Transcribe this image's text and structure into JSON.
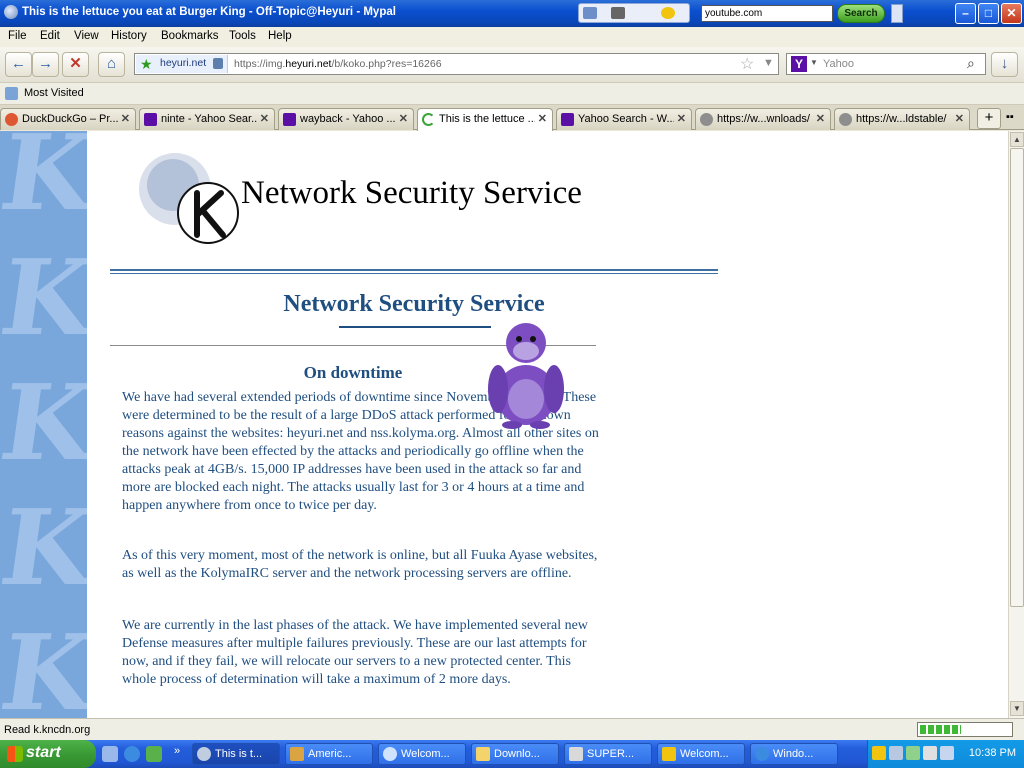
{
  "window": {
    "title": "This is the lettuce you eat at Burger King - Off-Topic@Heyuri - Mypal",
    "toolbar_search_value": "youtube.com",
    "toolbar_search_button": "Search"
  },
  "menu": [
    "File",
    "Edit",
    "View",
    "History",
    "Bookmarks",
    "Tools",
    "Help"
  ],
  "navigation": {
    "site_identity": "heyuri.net",
    "url_prefix": "https://img.",
    "url_host": "heyuri.net",
    "url_path": "/b/koko.php?res=16266",
    "search_engine": "Yahoo"
  },
  "bookmarks": {
    "most_visited": "Most Visited"
  },
  "tabs": [
    {
      "label": "DuckDuckGo – Pr...",
      "icon": "duckduckgo-icon",
      "active": false
    },
    {
      "label": "ninte - Yahoo Sear...",
      "icon": "yahoo-icon",
      "active": false
    },
    {
      "label": "wayback - Yahoo ...",
      "icon": "yahoo-icon",
      "active": false
    },
    {
      "label": "This is the lettuce ...",
      "icon": "loading-icon",
      "active": true
    },
    {
      "label": "Yahoo Search - W...",
      "icon": "yahoo-icon",
      "active": false
    },
    {
      "label": "https://w...wnloads/",
      "icon": "globe-icon",
      "active": false
    },
    {
      "label": "https://w...ldstable/",
      "icon": "globe-icon",
      "active": false
    }
  ],
  "page": {
    "header_title": "Network Security Service",
    "section_title": "Network Security Service",
    "sub_title": "On downtime",
    "paragraphs": [
      "We have had several extended periods of downtime since November this year. These were determined to be the result of a large DDoS attack performed for unknown reasons against the websites: heyuri.net and nss.kolyma.org. Almost all other sites on the network have been effected by the attacks and periodically go offline when the attacks peak at 4GB/s. 15,000 IP addresses have been used in the attack so far and more are blocked each night. The attacks usually last for 3 or 4 hours at a time and happen anywhere from once to twice per day.",
      "As of this very moment, most of the network is online, but all Fuuka Ayase websites, as well as the KolymaIRC server and the network processing servers are offline.",
      "We are currently in the last phases of the attack. We have implemented several new Defense measures after multiple failures previously. These are our last attempts for now, and if they fail, we will relocate our servers to a new protected center. This whole process of determination will take a maximum of 2 more days."
    ]
  },
  "status": {
    "text": "Read k.kncdn.org",
    "progress": 0.45
  },
  "taskbar": {
    "start": "start",
    "tasks": [
      {
        "label": "This is t...",
        "active": true,
        "icon": "mypal-icon"
      },
      {
        "label": "Americ...",
        "active": false,
        "icon": "cat-icon"
      },
      {
        "label": "Welcom...",
        "active": false,
        "icon": "chat-icon"
      },
      {
        "label": "Downlo...",
        "active": false,
        "icon": "folder-icon"
      },
      {
        "label": "SUPER...",
        "active": false,
        "icon": "floppy-icon"
      },
      {
        "label": "Welcom...",
        "active": false,
        "icon": "messenger-icon"
      },
      {
        "label": "Windo...",
        "active": false,
        "icon": "ie-icon"
      }
    ],
    "clock": "10:38 PM"
  }
}
